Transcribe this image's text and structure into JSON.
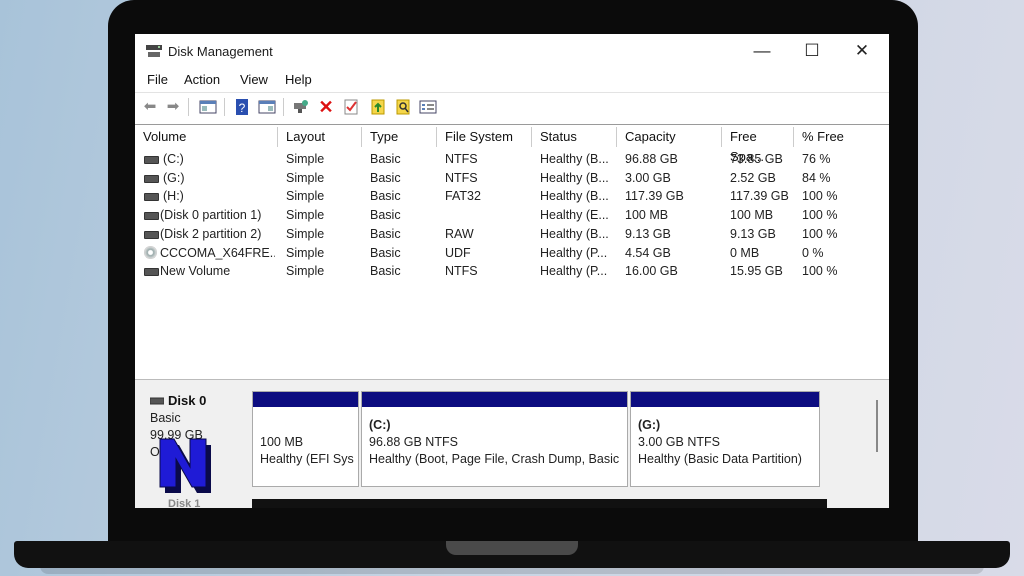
{
  "window": {
    "title": "Disk Management",
    "controls": {
      "minimize": "—",
      "maximize": "☐",
      "close": "✕"
    }
  },
  "menu": [
    "File",
    "Action",
    "View",
    "Help"
  ],
  "toolbar": {
    "icons": [
      "back-icon",
      "forward-icon",
      "console-tree-icon",
      "help-icon",
      "properties-icon",
      "connect-icon",
      "delete-icon",
      "check-icon",
      "import-icon",
      "search-icon",
      "settings-list-icon"
    ]
  },
  "volume_table": {
    "columns": [
      "Volume",
      "Layout",
      "Type",
      "File System",
      "Status",
      "Capacity",
      "Free Spa...",
      "% Free"
    ],
    "rows": [
      {
        "icon": "drive-icon",
        "volume": "(C:)",
        "layout": "Simple",
        "type": "Basic",
        "fs": "NTFS",
        "status": "Healthy (B...",
        "capacity": "96.88 GB",
        "free": "73.85 GB",
        "pct": "76 %"
      },
      {
        "icon": "drive-icon",
        "volume": "(G:)",
        "layout": "Simple",
        "type": "Basic",
        "fs": "NTFS",
        "status": "Healthy (B...",
        "capacity": "3.00 GB",
        "free": "2.52 GB",
        "pct": "84 %"
      },
      {
        "icon": "drive-icon",
        "volume": "(H:)",
        "layout": "Simple",
        "type": "Basic",
        "fs": "FAT32",
        "status": "Healthy (B...",
        "capacity": "117.39 GB",
        "free": "117.39 GB",
        "pct": "100 %"
      },
      {
        "icon": "drive-icon",
        "volume": "(Disk 0 partition 1)",
        "layout": "Simple",
        "type": "Basic",
        "fs": "",
        "status": "Healthy (E...",
        "capacity": "100 MB",
        "free": "100 MB",
        "pct": "100 %"
      },
      {
        "icon": "drive-icon",
        "volume": "(Disk 2 partition 2)",
        "layout": "Simple",
        "type": "Basic",
        "fs": "RAW",
        "status": "Healthy (B...",
        "capacity": "9.13 GB",
        "free": "9.13 GB",
        "pct": "100 %"
      },
      {
        "icon": "cd-icon",
        "volume": "CCCOMA_X64FRE...",
        "layout": "Simple",
        "type": "Basic",
        "fs": "UDF",
        "status": "Healthy (P...",
        "capacity": "4.54 GB",
        "free": "0 MB",
        "pct": "0 %"
      },
      {
        "icon": "drive-icon",
        "volume": "New Volume",
        "layout": "Simple",
        "type": "Basic",
        "fs": "NTFS",
        "status": "Healthy (P...",
        "capacity": "16.00 GB",
        "free": "15.95 GB",
        "pct": "100 %"
      }
    ]
  },
  "disk0": {
    "name": "Disk 0",
    "type": "Basic",
    "size": "99.99 GB",
    "status_partial": "O",
    "partitions": [
      {
        "label": "",
        "size": "100 MB",
        "status": "Healthy (EFI Sys"
      },
      {
        "label": "(C:)",
        "size": "96.88 GB NTFS",
        "status": "Healthy (Boot, Page File, Crash Dump, Basic"
      },
      {
        "label": "(G:)",
        "size": "3.00 GB NTFS",
        "status": "Healthy (Basic Data Partition)"
      }
    ]
  },
  "disk1": {
    "name_partial": "Disk 1"
  },
  "colors": {
    "partition_bar": "#0c0c80",
    "logo_fill": "#1f1bd6",
    "logo_shadow": "#0a0a4a"
  }
}
